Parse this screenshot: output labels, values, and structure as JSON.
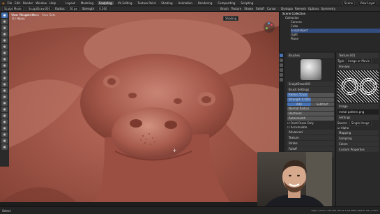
{
  "menu": {
    "items": [
      "File",
      "Edit",
      "Render",
      "Window",
      "Help"
    ],
    "workspaces": [
      "Layout",
      "Modeling",
      "Sculpting",
      "UV Editing",
      "Texture Paint",
      "Shading",
      "Animation",
      "Rendering",
      "Compositing",
      "Scripting"
    ],
    "active_workspace": "Sculpting",
    "scene": "Scene",
    "view_layer": "View Layer"
  },
  "header": {
    "mode": "Sculpt Mode",
    "brush": "SculptDraw.001",
    "radius_label": "Radius",
    "radius_value": "50 px",
    "strength_label": "Strength",
    "strength_value": "0.500",
    "menus": [
      "View",
      "Sculpt",
      "Mask",
      "Face Sets"
    ],
    "right_menus": [
      "Brush",
      "Texture",
      "Stroke",
      "Falloff",
      "Cursor"
    ],
    "dyntopo": "Dyntopo",
    "remesh": "Remesh",
    "options": "Options",
    "symmetry": "Symmetry"
  },
  "viewport": {
    "view_name": "User Perspective",
    "object_info": "(1) Hippo",
    "shading_label": "Shading"
  },
  "outliner": {
    "title": "Scene Collection",
    "items": [
      {
        "label": "Collection",
        "indent": false
      },
      {
        "label": "Camera",
        "indent": true
      },
      {
        "label": "Cube",
        "indent": true
      },
      {
        "label": "Sculptobject",
        "indent": true
      },
      {
        "label": "Light",
        "indent": true
      },
      {
        "label": "Plane",
        "indent": true
      }
    ]
  },
  "properties": {
    "sections": [
      "Brushes",
      "Brush Settings"
    ],
    "brush_name": "SculptDraw.001",
    "radius_label": "Radius",
    "radius_value": "50 px",
    "radius_fill": 0.45,
    "strength_label": "Strength",
    "strength_value": "0.500",
    "strength_fill": 0.5,
    "direction": [
      "Add",
      "Subtract"
    ],
    "normal_radius": "Normal Radius",
    "hardness": "Hardness",
    "autosmooth": "Autosmooth",
    "front_faces": "Front Faces Only",
    "accumulate": "Accumulate",
    "subsections": [
      "Advanced",
      "Texture",
      "Stroke",
      "Falloff",
      "Cursor"
    ]
  },
  "texture_panel": {
    "name": "Texture.001",
    "type_label": "Type",
    "type_value": "Image or Movie",
    "preview_label": "Preview",
    "image_section": "Image",
    "image_file": "metal pattern.png",
    "settings_label": "Settings",
    "source_label": "Source",
    "source_value": "Single Image",
    "colors": "Colors",
    "mapping": "Mapping",
    "sampling": "Sampling",
    "alpha": "Alpha",
    "custom_props": "Custom Properties"
  },
  "status": {
    "left": "Select",
    "right": "Hippo | Verts 1,221,890 | Faces 1,221,888 | Objects 0/1 | 3.00.0"
  },
  "colors": {
    "accent": "#4772b3",
    "clay": "#a3594b"
  }
}
